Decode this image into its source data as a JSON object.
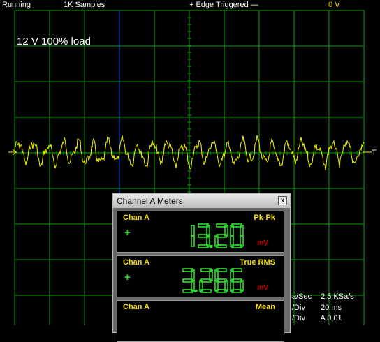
{
  "status": {
    "run_state": "Running",
    "samples": "1K Samples",
    "trigger": "+ Edge Triggered  —",
    "trigger_level": "0 V"
  },
  "overlay_label": "12 V 100% load",
  "scope": {
    "background": "#000000",
    "grid_color": "#00a000",
    "trace_color": "#f4f400",
    "cursor_color": "#0050ff",
    "trigger_marker": "T"
  },
  "meters": {
    "title": "Channel A Meters",
    "close_label": "x",
    "items": [
      {
        "channel": "Chan A",
        "type": "Pk-Pk",
        "sign": "+",
        "value": "13.20",
        "unit": "mV"
      },
      {
        "channel": "Chan A",
        "type": "True RMS",
        "sign": "+",
        "value": "3.266",
        "unit": "mV"
      },
      {
        "channel": "Chan A",
        "type": "Mean",
        "sign": "",
        "value": "",
        "unit": ""
      }
    ]
  },
  "info": {
    "rate_label": "a/Sec",
    "rate_value": "2,5 KSa/s",
    "tdiv_label": "/Div",
    "tdiv_value": "20 ms",
    "vdiv_label": "/Div",
    "vdiv_value": "A 0,01"
  }
}
